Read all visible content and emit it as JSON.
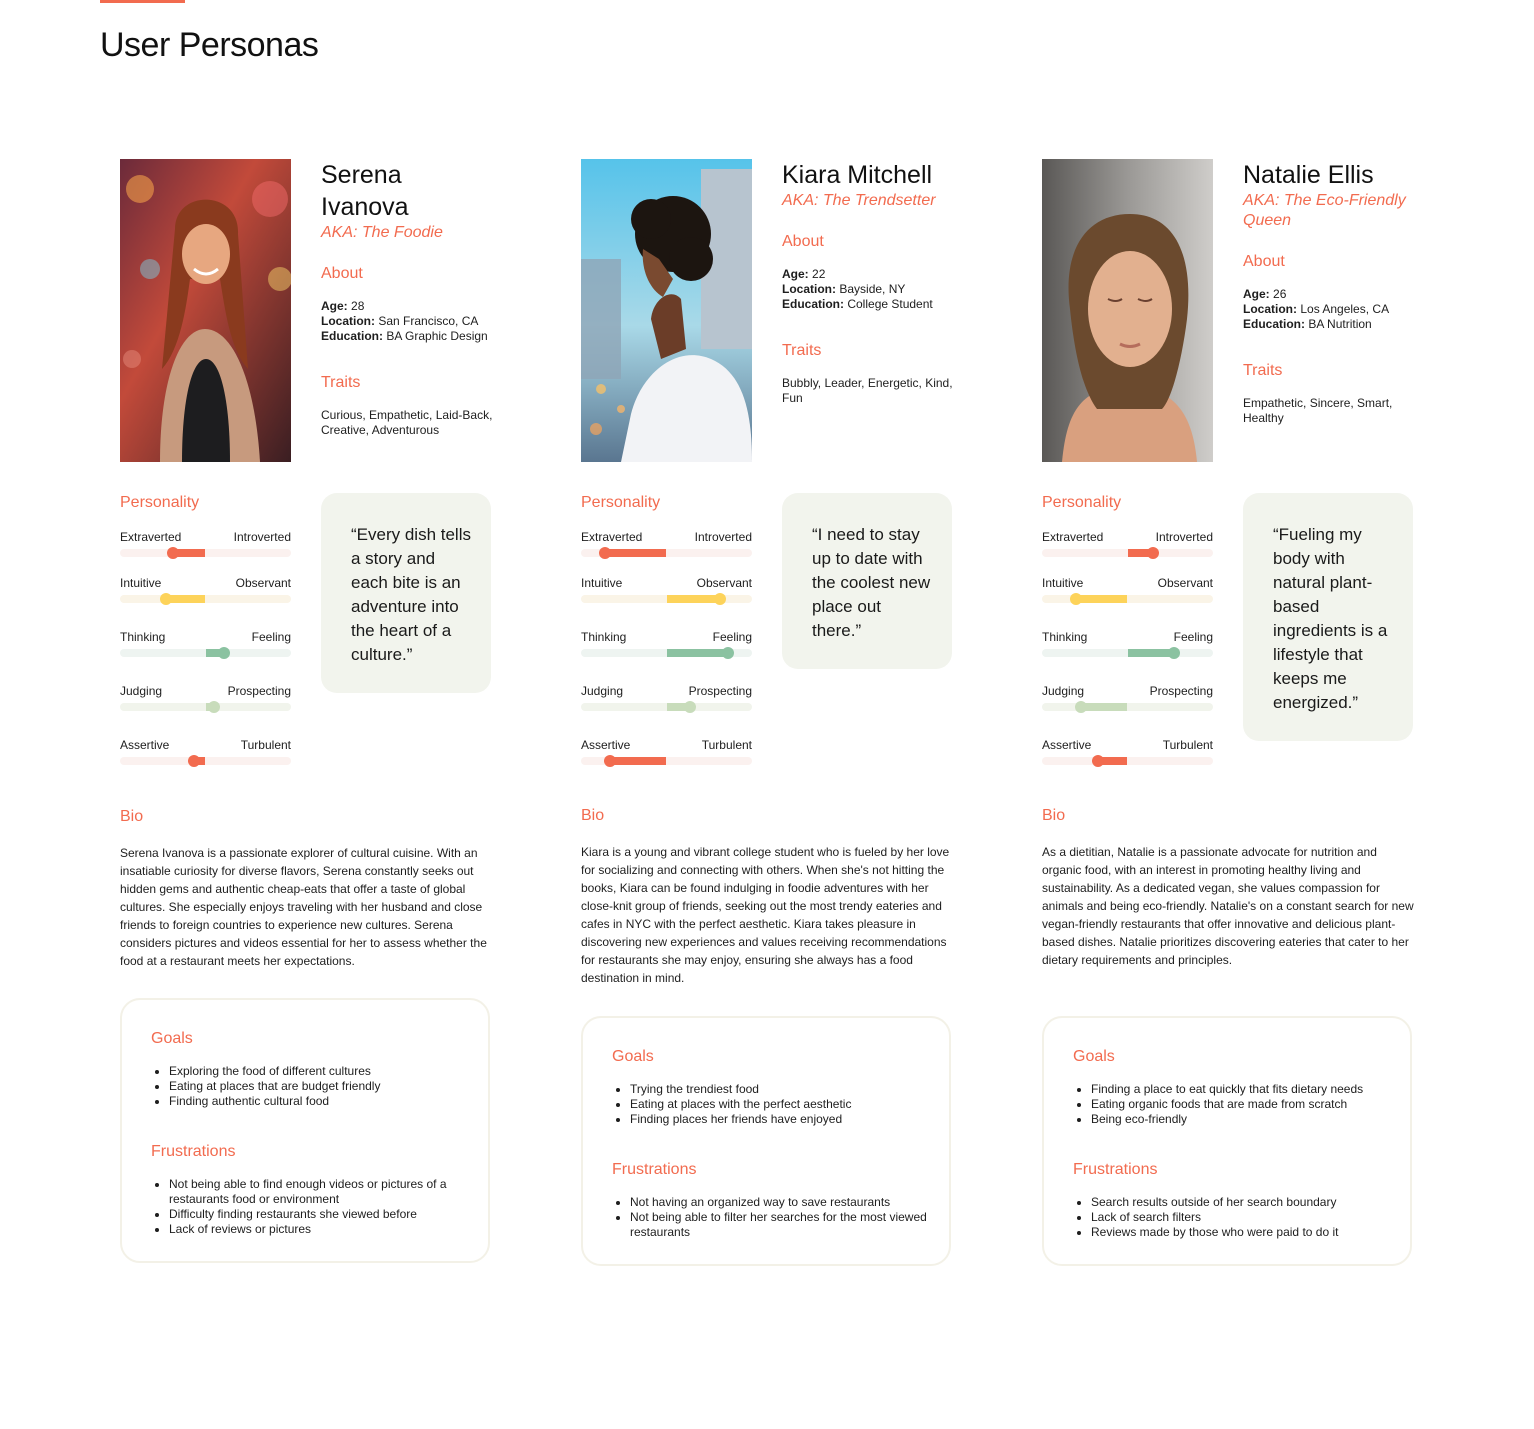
{
  "page": {
    "title": "User Personas",
    "accent": "#f26b4f"
  },
  "labels": {
    "about": "About",
    "traits": "Traits",
    "personality": "Personality",
    "bio": "Bio",
    "goals": "Goals",
    "frustrations": "Frustrations",
    "age": "Age:",
    "location": "Location:",
    "education": "Education:"
  },
  "slider_colors": {
    "ei": {
      "fill": "#f26b4f",
      "track": "#fbf1ef"
    },
    "no": {
      "fill": "#fdd35a",
      "track": "#faf4e7"
    },
    "tf": {
      "fill": "#8bc2a1",
      "track": "#eef4f1"
    },
    "jp": {
      "fill": "#c8dcbb",
      "track": "#f1f4ec"
    },
    "at": {
      "fill": "#f26b4f",
      "track": "#fbf1ef"
    }
  },
  "personas": [
    {
      "name": "Serena Ivanova",
      "aka": "AKA: The Foodie",
      "photo_icon": "portrait-smiling-woman-lights",
      "age": "28",
      "location": "San Francisco, CA",
      "education": "BA Graphic Design",
      "traits": "Curious, Empathetic, Laid-Back, Creative, Adventurous",
      "quote": "“Every dish tells a story and each bite is an adventure into the heart of a culture.”",
      "personality": [
        {
          "key": "ei",
          "left": "Extraverted",
          "right": "Introverted",
          "value": 0.31
        },
        {
          "key": "no",
          "left": "Intuitive",
          "right": "Observant",
          "value": 0.27
        },
        {
          "key": "tf",
          "left": "Thinking",
          "right": "Feeling",
          "value": 0.61
        },
        {
          "key": "jp",
          "left": "Judging",
          "right": "Prospecting",
          "value": 0.55
        },
        {
          "key": "at",
          "left": "Assertive",
          "right": "Turbulent",
          "value": 0.43
        }
      ],
      "bio": "Serena Ivanova is a passionate explorer of cultural cuisine. With an insatiable curiosity for diverse flavors, Serena constantly seeks out hidden gems and authentic cheap-eats that offer a taste of global cultures. She especially enjoys traveling with her husband and close friends to foreign countries to experience new cultures. Serena considers pictures and videos essential for her to assess whether the food at a restaurant meets her expectations.",
      "goals": [
        "Exploring the food of different cultures",
        "Eating at places that are budget friendly",
        "Finding authentic cultural food"
      ],
      "frustrations": [
        "Not being able to find enough videos or pictures of a restaurants food or environment",
        "Difficulty finding restaurants she viewed before",
        "Lack of reviews or pictures"
      ]
    },
    {
      "name": "Kiara Mitchell",
      "aka": "AKA: The Trendsetter",
      "photo_icon": "portrait-woman-city-skyline",
      "age": "22",
      "location": "Bayside, NY",
      "education": "College Student",
      "traits": "Bubbly, Leader, Energetic, Kind, Fun",
      "quote": "“I need to stay up to date with the coolest new place out there.”",
      "personality": [
        {
          "key": "ei",
          "left": "Extraverted",
          "right": "Introverted",
          "value": 0.14
        },
        {
          "key": "no",
          "left": "Intuitive",
          "right": "Observant",
          "value": 0.81
        },
        {
          "key": "tf",
          "left": "Thinking",
          "right": "Feeling",
          "value": 0.86
        },
        {
          "key": "jp",
          "left": "Judging",
          "right": "Prospecting",
          "value": 0.64
        },
        {
          "key": "at",
          "left": "Assertive",
          "right": "Turbulent",
          "value": 0.17
        }
      ],
      "bio": "Kiara is a young and vibrant college student who is fueled by her love for socializing and connecting with others. When she's not hitting the books, Kiara can be found indulging in foodie adventures with her close-knit group of friends, seeking out the most trendy eateries and cafes in NYC with the perfect aesthetic. Kiara takes pleasure in discovering new experiences and values receiving recommendations for restaurants she may enjoy, ensuring she always has a food destination in mind.",
      "goals": [
        "Trying the trendiest food",
        "Eating at places with the perfect aesthetic",
        "Finding places her friends have enjoyed"
      ],
      "frustrations": [
        "Not having an organized way to save restaurants",
        "Not being able to filter her searches for the most viewed restaurants"
      ]
    },
    {
      "name": "Natalie Ellis",
      "aka": "AKA: The Eco-Friendly Queen",
      "photo_icon": "portrait-woman-eyes-closed-sunlight",
      "age": "26",
      "location": "Los Angeles, CA",
      "education": "BA Nutrition",
      "traits": "Empathetic, Sincere, Smart, Healthy",
      "quote": "“Fueling my body with natural plant-based ingredients is a lifestyle that keeps me energized.”",
      "personality": [
        {
          "key": "ei",
          "left": "Extraverted",
          "right": "Introverted",
          "value": 0.65
        },
        {
          "key": "no",
          "left": "Intuitive",
          "right": "Observant",
          "value": 0.2
        },
        {
          "key": "tf",
          "left": "Thinking",
          "right": "Feeling",
          "value": 0.77
        },
        {
          "key": "jp",
          "left": "Judging",
          "right": "Prospecting",
          "value": 0.23
        },
        {
          "key": "at",
          "left": "Assertive",
          "right": "Turbulent",
          "value": 0.33
        }
      ],
      "bio": "As a dietitian, Natalie is a passionate advocate for nutrition and organic food, with an interest in promoting healthy living and sustainability. As a dedicated vegan, she values compassion for animals and being eco-friendly. Natalie's on a constant search for new vegan-friendly restaurants that offer innovative and delicious plant-based dishes. Natalie prioritizes discovering eateries that cater to her dietary requirements and principles.",
      "goals": [
        "Finding a place to eat quickly that fits dietary needs",
        "Eating organic foods that are made from scratch",
        "Being eco-friendly"
      ],
      "frustrations": [
        "Search results outside of her search boundary",
        "Lack of search filters",
        "Reviews made by those who were paid to do it"
      ]
    }
  ]
}
